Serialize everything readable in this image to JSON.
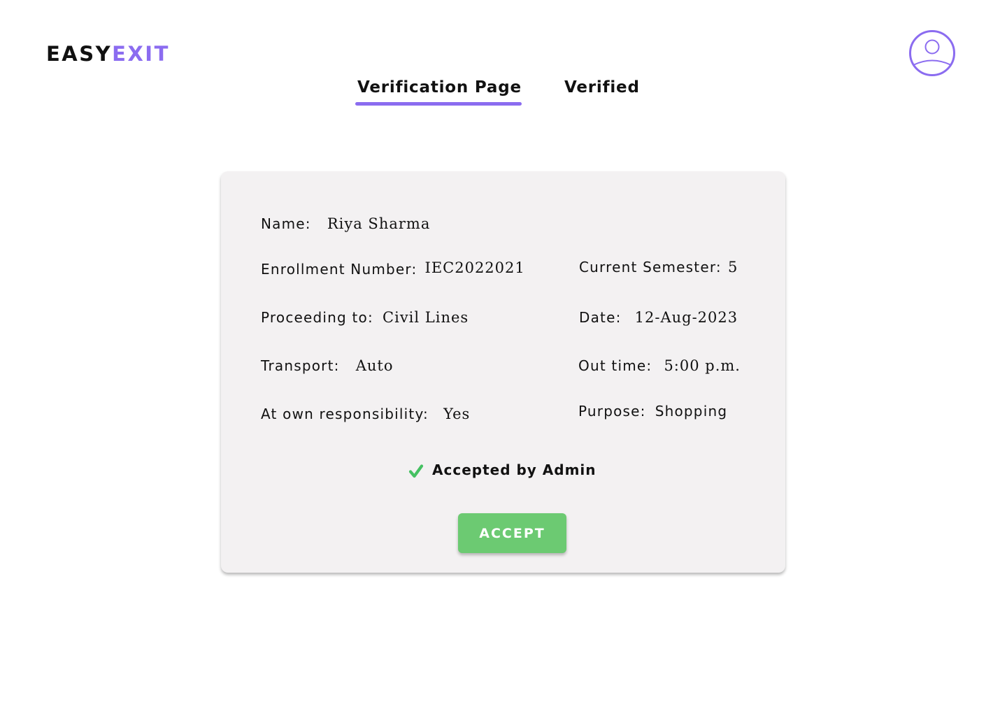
{
  "app": {
    "logo_part1": "EASY",
    "logo_part2": "EXIT",
    "logo_part2_color": "#8b6cf0"
  },
  "header": {
    "avatar_icon": "user-circle-icon"
  },
  "tabs": [
    {
      "label": "Verification Page",
      "active": true
    },
    {
      "label": "Verified",
      "active": false
    }
  ],
  "accent_color": "#8b6cf0",
  "card": {
    "name": {
      "label": "Name:",
      "value": "Riya Sharma"
    },
    "enrollment": {
      "label": "Enrollment Number:",
      "value": "IEC2022021"
    },
    "semester": {
      "label": "Current Semester:",
      "value": "5"
    },
    "proceeding": {
      "label": "Proceeding to:",
      "value": "Civil Lines"
    },
    "date": {
      "label": "Date:",
      "value": "12-Aug-2023"
    },
    "transport": {
      "label": "Transport:",
      "value": "Auto"
    },
    "out_time": {
      "label": "Out time:",
      "value": "5:00 p.m."
    },
    "responsibility": {
      "label": "At own responsibility:",
      "value": "Yes"
    },
    "purpose": {
      "label": "Purpose:",
      "value": "Shopping"
    },
    "status": {
      "icon": "check-icon",
      "text": "Accepted by Admin",
      "color": "#45c162"
    },
    "accept_button": {
      "label": "ACCEPT",
      "color": "#6cca72"
    }
  }
}
